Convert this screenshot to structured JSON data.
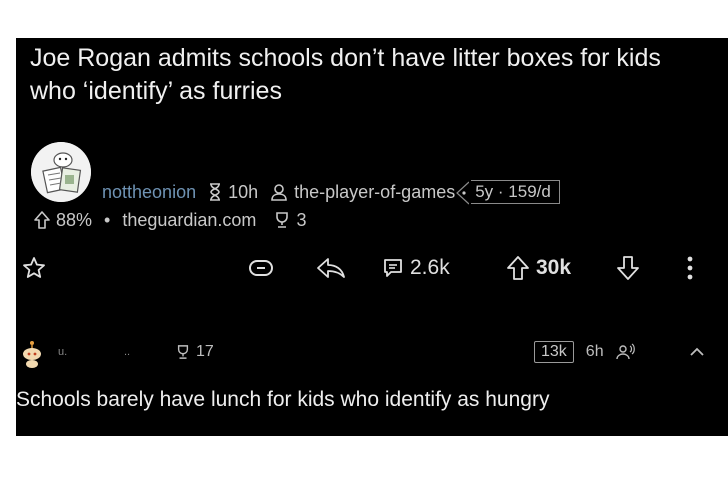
{
  "post": {
    "title": "Joe Rogan admits schools don’t have litter boxes for kids who ‘identify’ as furries",
    "subreddit": "nottheonion",
    "age": "10h",
    "author": "the-player-of-games",
    "author_flair": "5y · 159/d",
    "upvote_ratio": "88%",
    "separator": "•",
    "domain": "theguardian.com",
    "awards_count": "3"
  },
  "actions": {
    "comments": "2.6k",
    "score": "30k"
  },
  "comment": {
    "user_blurred": "u.",
    "user_blurred_tail": "..",
    "awards_count": "17",
    "score_badge": "13k",
    "age": "6h",
    "text": "Schools barely have lunch for kids who identify as hungry"
  },
  "colors": {
    "background": "#000000",
    "subreddit": "#6f93b4",
    "text": "#d8d8d8"
  },
  "icons": [
    "hourglass-icon",
    "user-icon",
    "upvote-icon",
    "award-icon",
    "star-icon",
    "link-icon",
    "share-icon",
    "comment-icon",
    "downvote-icon",
    "more-icon",
    "snoo-avatar-icon",
    "people-icon",
    "collapse-icon"
  ]
}
